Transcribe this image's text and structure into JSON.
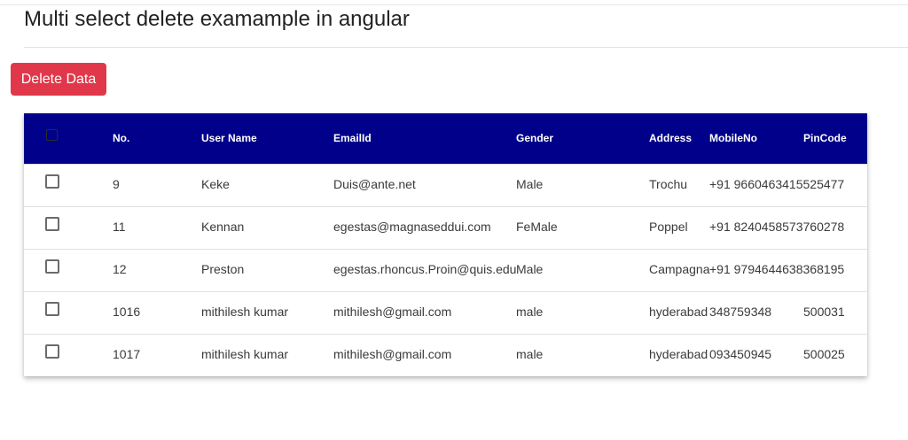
{
  "page": {
    "title": "Multi select delete examample in angular"
  },
  "toolbar": {
    "delete_label": "Delete Data"
  },
  "colors": {
    "header_bg": "#00008b",
    "delete_button_bg": "#e0384a"
  },
  "table": {
    "columns": [
      "No.",
      "User Name",
      "EmailId",
      "Gender",
      "Address",
      "MobileNo",
      "PinCode"
    ],
    "rows": [
      {
        "no": "9",
        "username": "Keke",
        "email": "Duis@ante.net",
        "gender": "Male",
        "address": "Trochu",
        "mobile": "+91 9660463415525477",
        "pincode": ""
      },
      {
        "no": "11",
        "username": "Kennan",
        "email": "egestas@magnaseddui.com",
        "gender": "FeMale",
        "address": "Poppel",
        "mobile": "+91 8240458573760278",
        "pincode": ""
      },
      {
        "no": "12",
        "username": "Preston",
        "email": "egestas.rhoncus.Proin@quis.edu",
        "gender": "Male",
        "address": "Campagna",
        "mobile": "+91 9794644638368195",
        "pincode": ""
      },
      {
        "no": "1016",
        "username": "mithilesh kumar",
        "email": "mithilesh@gmail.com",
        "gender": "male",
        "address": "hyderabad",
        "mobile": "348759348",
        "pincode": "500031"
      },
      {
        "no": "1017",
        "username": "mithilesh kumar",
        "email": "mithilesh@gmail.com",
        "gender": "male",
        "address": "hyderabad",
        "mobile": "093450945",
        "pincode": "500025"
      }
    ]
  }
}
